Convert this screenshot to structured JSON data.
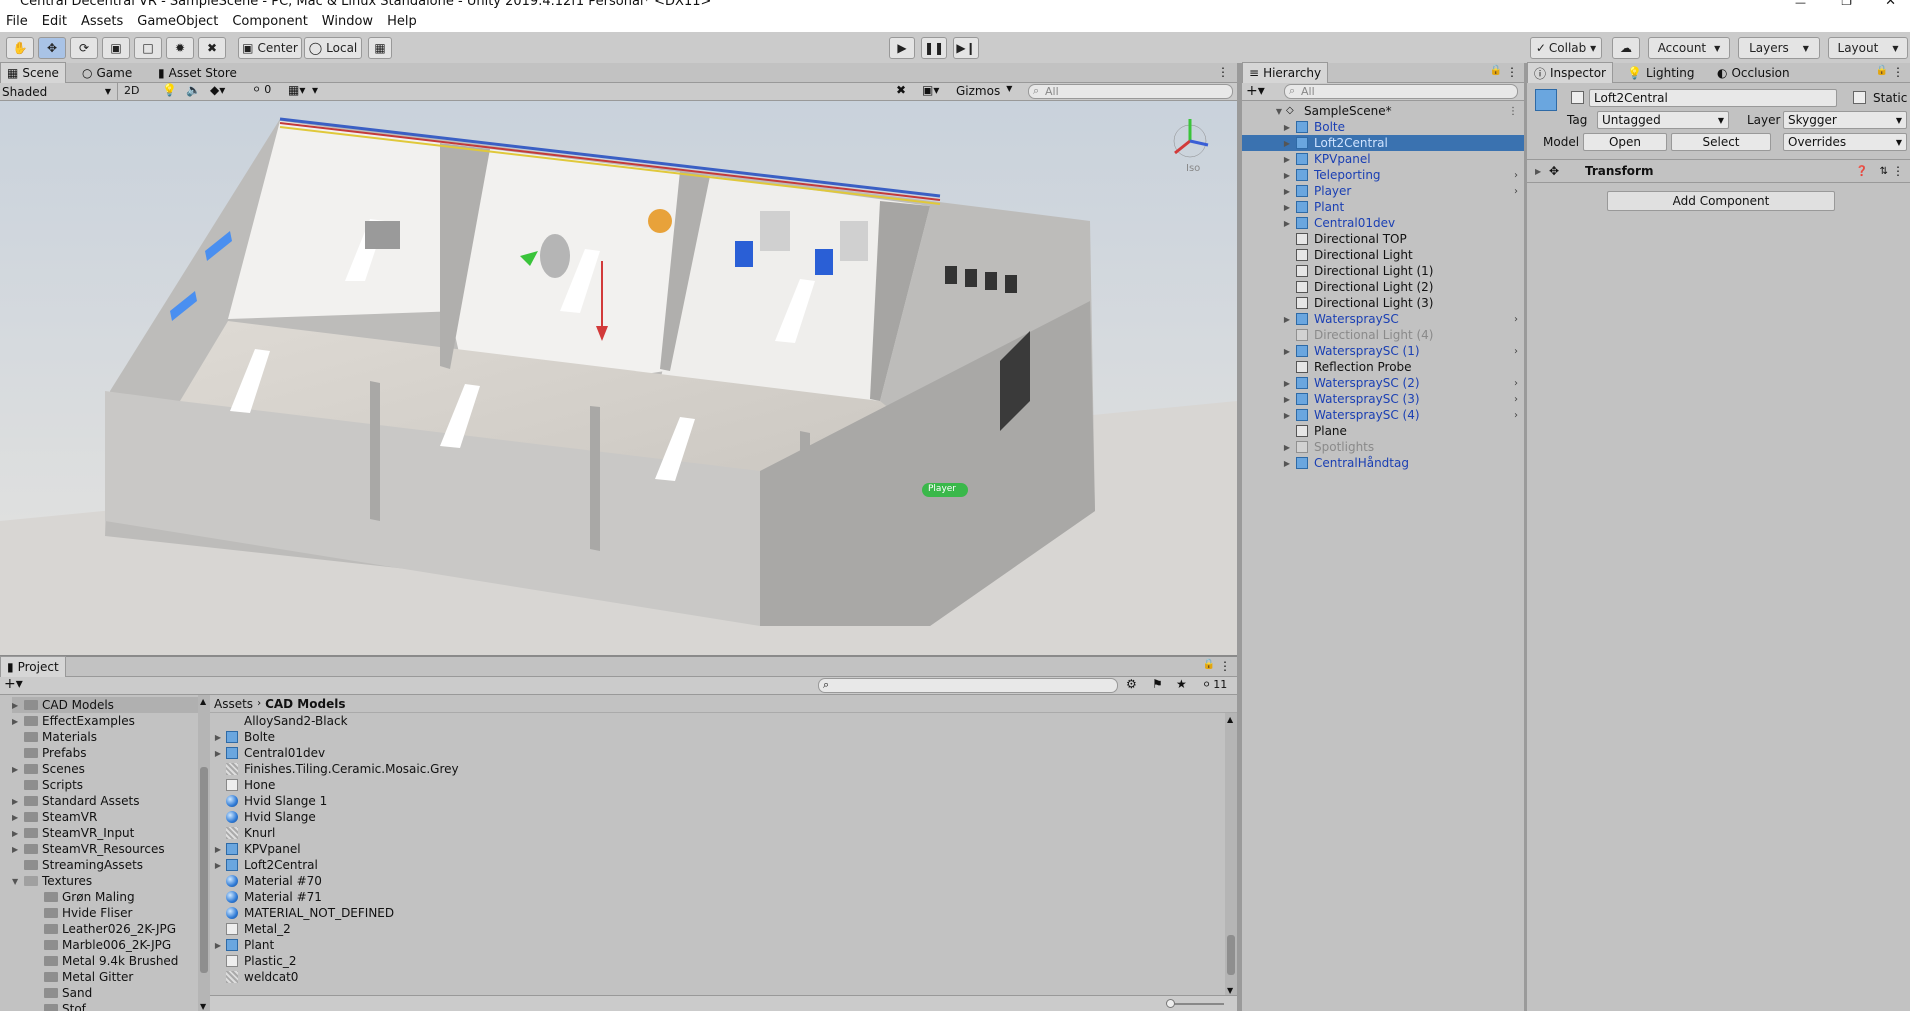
{
  "window": {
    "title": "Central Decentral VR - SampleScene - PC, Mac & Linux Standalone - Unity 2019.4.12f1 Personal* <DX11>"
  },
  "menu": [
    "File",
    "Edit",
    "Assets",
    "GameObject",
    "Component",
    "Window",
    "Help"
  ],
  "toolbar": {
    "pivot": "Center",
    "space": "Local",
    "collab": "Collab ▾",
    "account": "Account",
    "layers": "Layers",
    "layout": "Layout"
  },
  "scene_tabs": {
    "scene": "Scene",
    "game": "Game",
    "store": "Asset Store"
  },
  "scene_bar": {
    "shading": "Shaded",
    "mode2d": "2D",
    "gizmos": "Gizmos",
    "search_placeholder": "All",
    "hidden_count": "0",
    "iso": "Iso"
  },
  "scene_labels": {
    "player": "Player"
  },
  "hierarchy": {
    "title": "Hierarchy",
    "search_placeholder": "All",
    "scene": "SampleScene*",
    "items": [
      {
        "label": "Bolte",
        "type": "prefab",
        "arrow": true,
        "chev": false
      },
      {
        "label": "Loft2Central",
        "type": "prefab",
        "arrow": true,
        "chev": false,
        "selected": true
      },
      {
        "label": "KPVpanel",
        "type": "prefab",
        "arrow": true,
        "chev": false
      },
      {
        "label": "Teleporting",
        "type": "prefab",
        "arrow": true,
        "chev": true
      },
      {
        "label": "Player",
        "type": "prefab",
        "arrow": true,
        "chev": true
      },
      {
        "label": "Plant",
        "type": "prefab",
        "arrow": true,
        "chev": false
      },
      {
        "label": "Central01dev",
        "type": "prefab",
        "arrow": true,
        "chev": false
      },
      {
        "label": "Directional TOP",
        "type": "go",
        "arrow": false,
        "chev": false
      },
      {
        "label": "Directional Light",
        "type": "go",
        "arrow": false,
        "chev": false
      },
      {
        "label": "Directional Light (1)",
        "type": "go",
        "arrow": false,
        "chev": false
      },
      {
        "label": "Directional Light (2)",
        "type": "go",
        "arrow": false,
        "chev": false
      },
      {
        "label": "Directional Light (3)",
        "type": "go",
        "arrow": false,
        "chev": false
      },
      {
        "label": "WaterspraySC",
        "type": "prefab",
        "arrow": true,
        "chev": true
      },
      {
        "label": "Directional Light (4)",
        "type": "disabled",
        "arrow": false,
        "chev": false
      },
      {
        "label": "WaterspraySC (1)",
        "type": "prefab",
        "arrow": true,
        "chev": true
      },
      {
        "label": "Reflection Probe",
        "type": "go",
        "arrow": false,
        "chev": false
      },
      {
        "label": "WaterspraySC (2)",
        "type": "prefab",
        "arrow": true,
        "chev": true
      },
      {
        "label": "WaterspraySC (3)",
        "type": "prefab",
        "arrow": true,
        "chev": true
      },
      {
        "label": "WaterspraySC (4)",
        "type": "prefab",
        "arrow": true,
        "chev": true
      },
      {
        "label": "Plane",
        "type": "go",
        "arrow": false,
        "chev": false
      },
      {
        "label": "Spotlights",
        "type": "disabled",
        "arrow": true,
        "chev": false
      },
      {
        "label": "CentralHåndtag",
        "type": "prefab",
        "arrow": true,
        "chev": false
      }
    ]
  },
  "inspector": {
    "tabs": [
      "Inspector",
      "Lighting",
      "Occlusion"
    ],
    "object_name": "Loft2Central",
    "static": "Static",
    "tag_label": "Tag",
    "tag": "Untagged",
    "layer_label": "Layer",
    "layer": "Skygger",
    "model_label": "Model",
    "open": "Open",
    "select": "Select",
    "overrides": "Overrides",
    "transform": "Transform",
    "add_component": "Add Component"
  },
  "project": {
    "title": "Project",
    "breadcrumb_root": "Assets",
    "breadcrumb_current": "CAD Models",
    "hidden_count": "11",
    "tree": [
      {
        "label": "CAD Models",
        "arrow": true,
        "indent": 0,
        "selected": true
      },
      {
        "label": "EffectExamples",
        "arrow": true,
        "indent": 0
      },
      {
        "label": "Materials",
        "arrow": false,
        "indent": 0
      },
      {
        "label": "Prefabs",
        "arrow": false,
        "indent": 0
      },
      {
        "label": "Scenes",
        "arrow": true,
        "indent": 0
      },
      {
        "label": "Scripts",
        "arrow": false,
        "indent": 0
      },
      {
        "label": "Standard Assets",
        "arrow": true,
        "indent": 0
      },
      {
        "label": "SteamVR",
        "arrow": true,
        "indent": 0
      },
      {
        "label": "SteamVR_Input",
        "arrow": true,
        "indent": 0
      },
      {
        "label": "SteamVR_Resources",
        "arrow": true,
        "indent": 0
      },
      {
        "label": "StreamingAssets",
        "arrow": false,
        "indent": 0
      },
      {
        "label": "Textures",
        "arrow": true,
        "indent": 0,
        "open": true
      },
      {
        "label": "Grøn Maling",
        "arrow": false,
        "indent": 1
      },
      {
        "label": "Hvide Fliser",
        "arrow": false,
        "indent": 1
      },
      {
        "label": "Leather026_2K-JPG",
        "arrow": false,
        "indent": 1
      },
      {
        "label": "Marble006_2K-JPG",
        "arrow": false,
        "indent": 1
      },
      {
        "label": "Metal 9.4k Brushed",
        "arrow": false,
        "indent": 1
      },
      {
        "label": "Metal Gitter",
        "arrow": false,
        "indent": 1
      },
      {
        "label": "Sand",
        "arrow": false,
        "indent": 1
      },
      {
        "label": "Stof",
        "arrow": false,
        "indent": 1
      }
    ],
    "assets": [
      {
        "label": "AlloySand2-Black",
        "icon": "none",
        "arrow": false
      },
      {
        "label": "Bolte",
        "icon": "prefab",
        "arrow": true
      },
      {
        "label": "Central01dev",
        "icon": "prefab",
        "arrow": true
      },
      {
        "label": "Finishes.Tiling.Ceramic.Mosaic.Grey",
        "icon": "tex",
        "arrow": false
      },
      {
        "label": "Hone",
        "icon": "mat",
        "arrow": false
      },
      {
        "label": "Hvid Slange 1",
        "icon": "sphere",
        "arrow": false
      },
      {
        "label": "Hvid Slange",
        "icon": "sphere",
        "arrow": false
      },
      {
        "label": "Knurl",
        "icon": "tex",
        "arrow": false
      },
      {
        "label": "KPVpanel",
        "icon": "prefab",
        "arrow": true
      },
      {
        "label": "Loft2Central",
        "icon": "prefab",
        "arrow": true
      },
      {
        "label": "Material #70",
        "icon": "sphere",
        "arrow": false
      },
      {
        "label": "Material #71",
        "icon": "sphere",
        "arrow": false
      },
      {
        "label": "MATERIAL_NOT_DEFINED",
        "icon": "sphere",
        "arrow": false
      },
      {
        "label": "Metal_2",
        "icon": "mat",
        "arrow": false
      },
      {
        "label": "Plant",
        "icon": "prefab",
        "arrow": true
      },
      {
        "label": "Plastic_2",
        "icon": "mat",
        "arrow": false
      },
      {
        "label": "weldcat0",
        "icon": "tex",
        "arrow": false
      }
    ]
  }
}
